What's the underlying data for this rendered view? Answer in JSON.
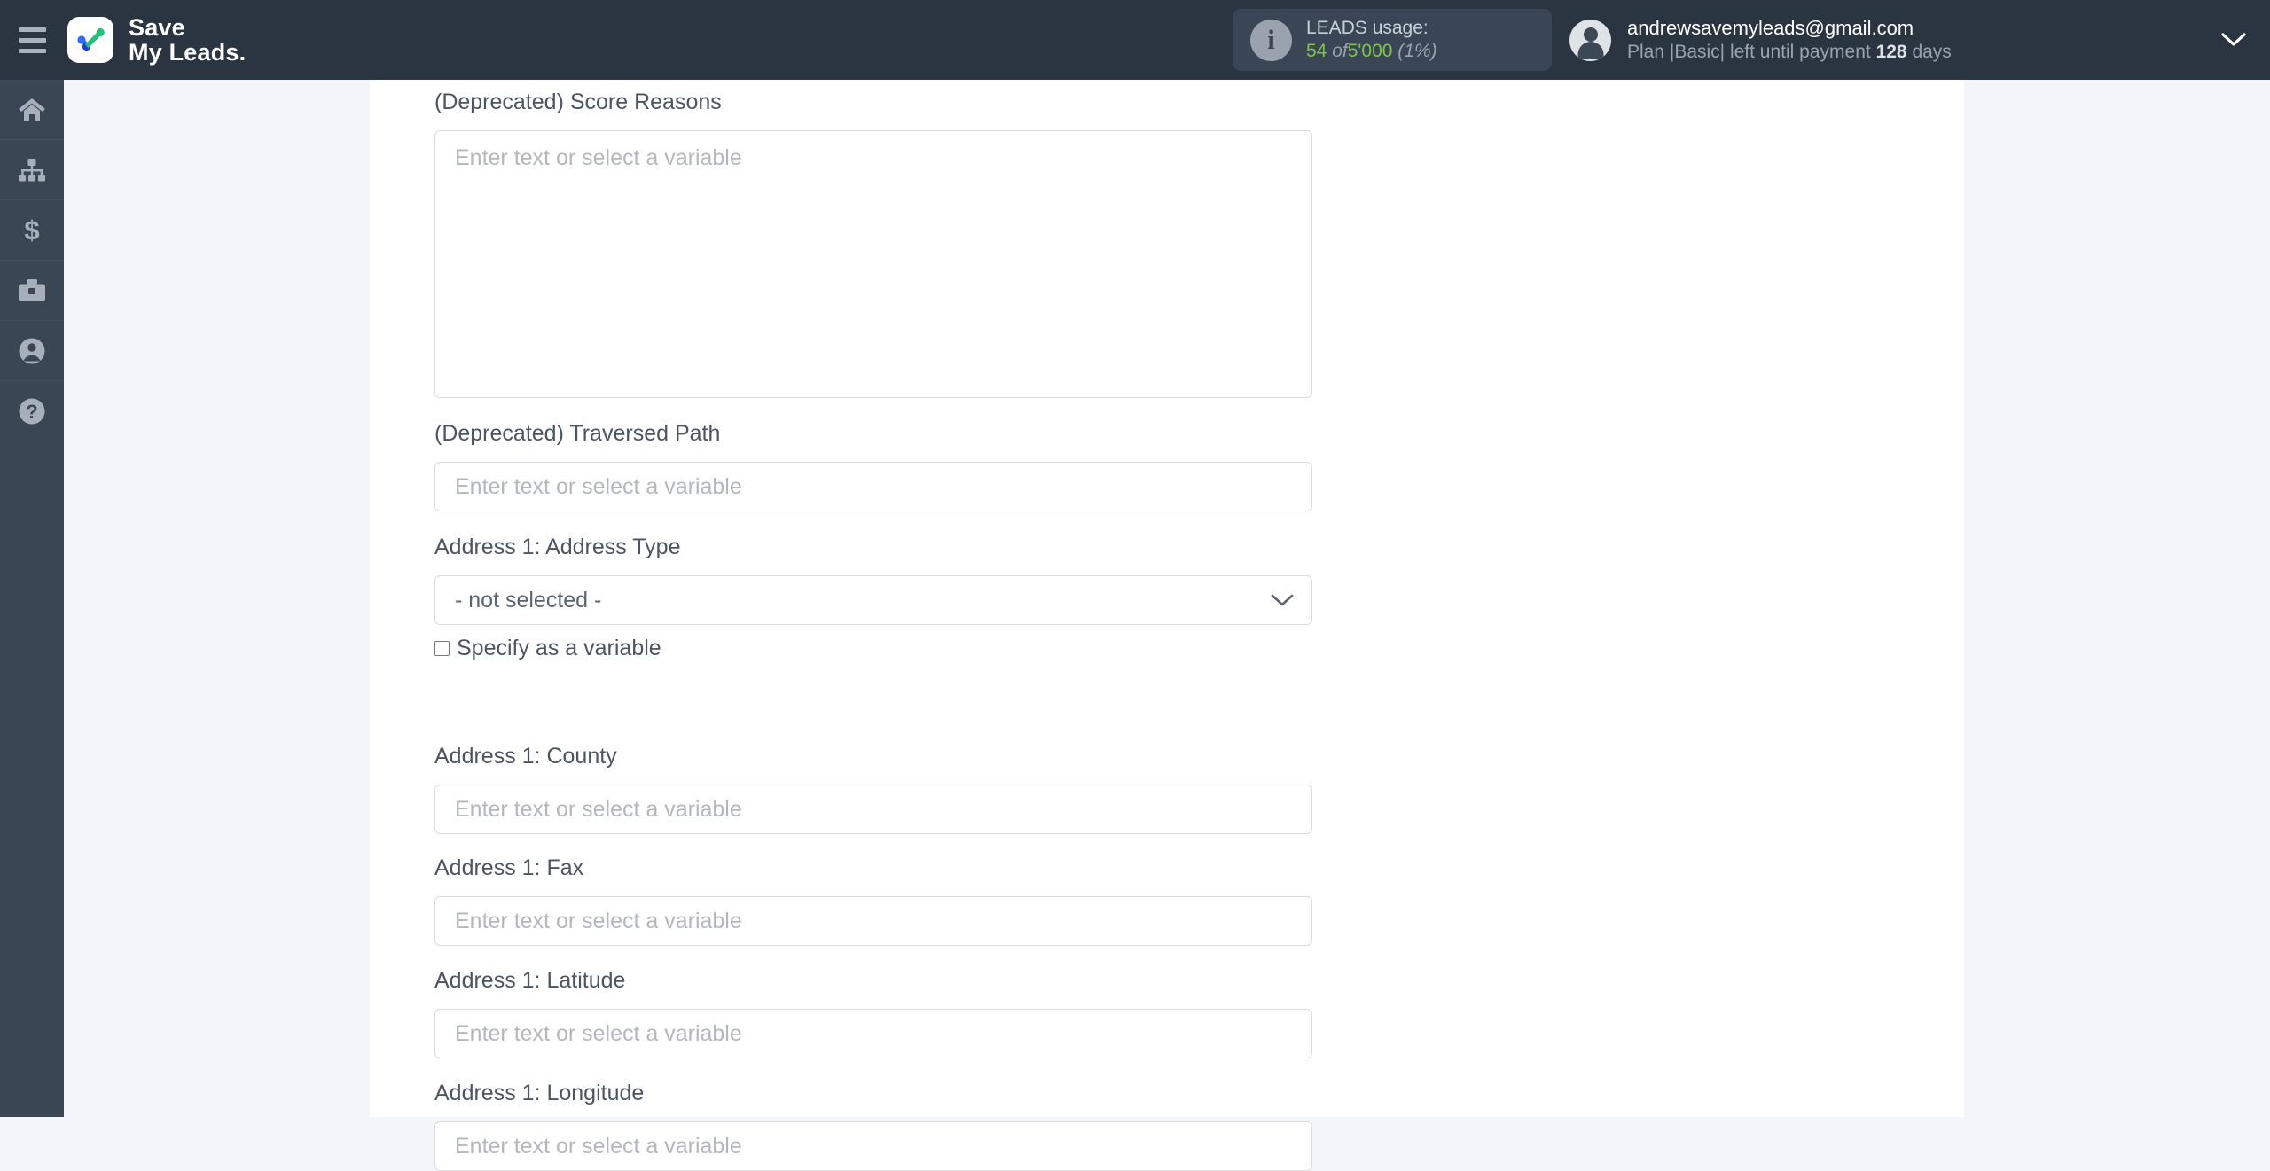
{
  "header": {
    "menu_icon": "hamburger-icon",
    "brand": {
      "line1": "Save",
      "line2": "My Leads.",
      "full": "Save\nMy Leads."
    },
    "usage": {
      "icon": "info-icon",
      "title": "LEADS usage:",
      "used": "54",
      "separator": "of",
      "total": "5'000",
      "percent": "(1%)"
    },
    "account": {
      "avatar_icon": "user-avatar-icon",
      "email": "andrewsavemyleads@gmail.com",
      "plan_prefix": "Plan |Basic| left until payment",
      "days_value": "128",
      "days_suffix": "days"
    },
    "caret_icon": "chevron-down-icon"
  },
  "sidebar": {
    "items": [
      {
        "name": "home",
        "icon": "home-icon",
        "label": "Home"
      },
      {
        "name": "connections",
        "icon": "sitemap-icon",
        "label": "Connections"
      },
      {
        "name": "billing",
        "icon": "dollar-icon",
        "label": "Billing"
      },
      {
        "name": "services",
        "icon": "briefcase-icon",
        "label": "Services"
      },
      {
        "name": "profile",
        "icon": "user-icon",
        "label": "Profile"
      },
      {
        "name": "help",
        "icon": "question-circle-icon",
        "label": "Help"
      }
    ]
  },
  "form": {
    "placeholder": "Enter text or select a variable",
    "checkbox_label": "Specify as a variable",
    "select_value": "- not selected -",
    "fields": [
      {
        "label": "(Deprecated) Score Reasons",
        "type": "textarea",
        "value": ""
      },
      {
        "label": "(Deprecated) Traversed Path",
        "type": "text",
        "value": ""
      },
      {
        "label": "Address 1: Address Type",
        "type": "select",
        "value": "- not selected -",
        "has_checkbox": true
      },
      {
        "label": "Address 1: County",
        "type": "text",
        "value": ""
      },
      {
        "label": "Address 1: Fax",
        "type": "text",
        "value": ""
      },
      {
        "label": "Address 1: Latitude",
        "type": "text",
        "value": ""
      },
      {
        "label": "Address 1: Longitude",
        "type": "text",
        "value": ""
      }
    ]
  },
  "colors": {
    "header_bg": "#2b3542",
    "sidebar_bg": "#3b4654",
    "page_bg": "#f2f5fa",
    "panel_bg": "#ffffff",
    "accent_green": "#7fc44b",
    "label_text": "#4c5663",
    "placeholder_text": "#b4b8bd"
  }
}
